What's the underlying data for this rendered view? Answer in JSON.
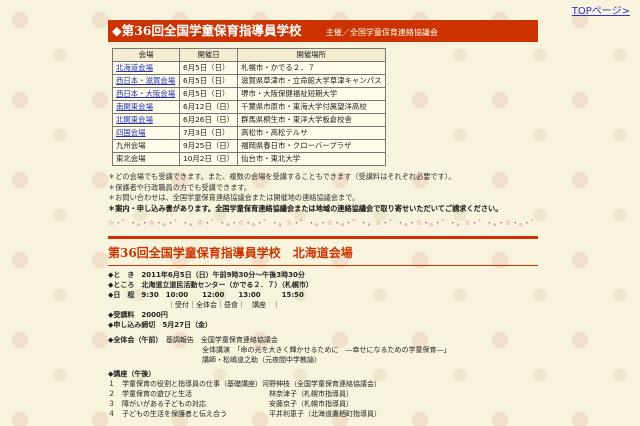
{
  "top_link": "TOPページ>",
  "banner": {
    "title": "◆第36回全国学童保育指導員学校",
    "organizer": "主催／全国学童保育連絡協議会"
  },
  "venue_table": {
    "headers": [
      "会場",
      "開催日",
      "開催場所"
    ],
    "rows": [
      {
        "venue": "北海道会場",
        "date": "6月5日（日）",
        "place": "札幌市・かでる２．７",
        "link": true
      },
      {
        "venue": "西日本・滋賀会場",
        "date": "6月5日（日）",
        "place": "滋賀県草津市・立命館大学草津キャンパス",
        "link": true
      },
      {
        "venue": "西日本・大阪会場",
        "date": "6月5日（日）",
        "place": "堺市・大阪保健福祉短期大学",
        "link": true
      },
      {
        "venue": "南関東会場",
        "date": "6月12日（日）",
        "place": "千葉県市原市・東海大学付属望洋高校",
        "link": true
      },
      {
        "venue": "北関東会場",
        "date": "6月26日（日）",
        "place": "群馬県桐生市・東洋大学板倉校舎",
        "link": true
      },
      {
        "venue": "四国会場",
        "date": "7月3日（日）",
        "place": "高松市・高松テルサ",
        "link": true
      },
      {
        "venue": "九州会場",
        "date": "9月25日（日）",
        "place": "福岡県春日市・クローバープラザ",
        "link": false
      },
      {
        "venue": "東北会場",
        "date": "10月2日（日）",
        "place": "仙台市・東北大学",
        "link": false
      }
    ]
  },
  "notes": [
    "＊どの会場でも受講できます。また、複数の会場を受講することもできます（受講料はそれぞれ必要です）。",
    "＊保護者や行政職員の方でも受講できます。",
    "＊お問い合わせは、全国学童保育連絡協議会または開催地の連絡協議会まで。"
  ],
  "notes_bold": "＊案内・申し込み書があります。全国学童保育連絡協議会または地域の連絡協議会で取り寄せいただいてご請求ください。",
  "separator": "☆・゜・。・☆・。・゜・。☆・゜・。・☆・。・゜・。☆・゜・。・☆・。・゜・。☆・゜・。・☆・。・゜・。☆・゜・。・☆・。・゜",
  "section": {
    "title": "第36回全国学童保育指導員学校　北海道会場",
    "when": "◆と　き　2011年6月5日（日）午前9時30分～午後3時30分",
    "where": "◆ところ　北海道立道民活動センター（かでる２．７）（札幌市）",
    "schedule": "◆日　程　9:30　10:00　　12:00　　13:00　　　15:50",
    "schedule_detail": "｜受付｜全体会｜昼食｜　講座　｜",
    "fee": "◆受講料　2000円",
    "deadline": "◆申し込み締切　5月27日（金）",
    "plenary_label": "◆全体会（午前）",
    "plenary_line1": "基調報告　全国学童保育連絡協議会",
    "plenary_line2": "全体講演　「命の光を大きく輝かせるために　―幸せになるための学童保育―」",
    "plenary_line3": "講師・松嶋道之助（元夜間中学教諭）",
    "courses_label": "◆講座（午後）",
    "courses": [
      "１　学童保育の役割と指導員の仕事（基礎講座）河野伸枝（全国学童保育連絡協議会）",
      "２　学童保育の遊びと生活　　　　　　　　　　　林奈津子（札幌市指導員）",
      "３　障がいがある子どもの対応　　　　　　　　　安藤京子（札幌市指導員）",
      "４　子どもの生活を保護者と伝え合う　　　　　　平井利恵子（北海道鷹栖町指導員）"
    ]
  }
}
